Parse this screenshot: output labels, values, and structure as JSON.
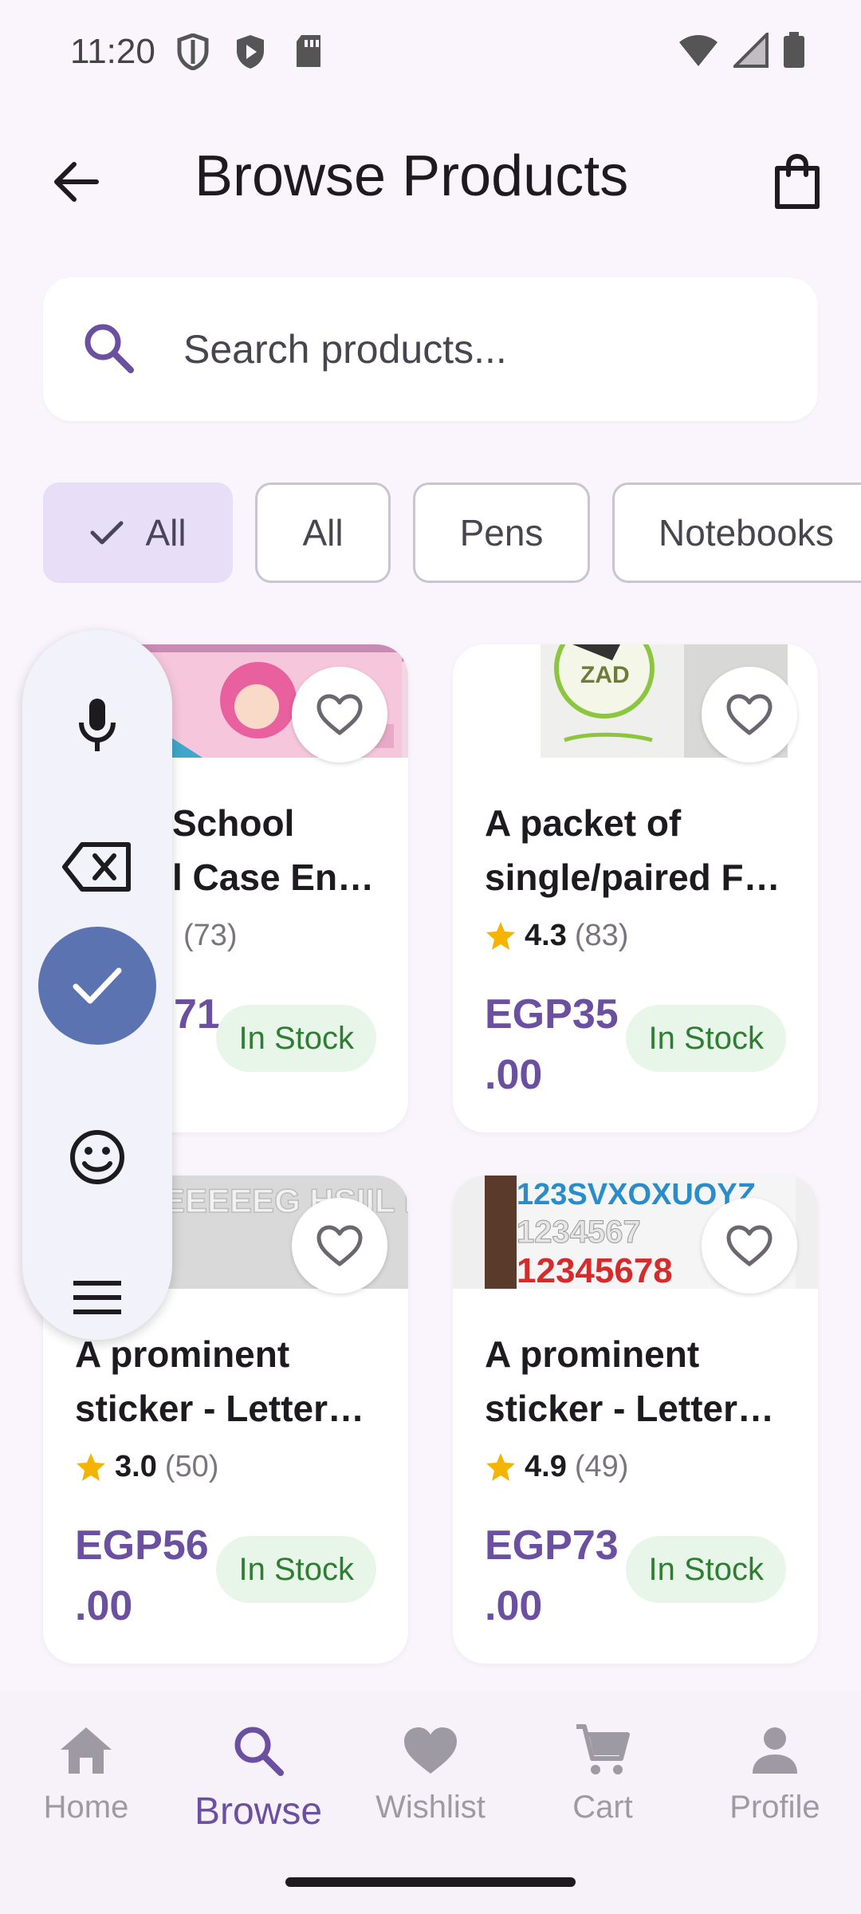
{
  "status_bar": {
    "time": "11:20"
  },
  "app_bar": {
    "title": "Browse Products"
  },
  "search": {
    "placeholder": "Search products..."
  },
  "filters": [
    {
      "label": "All",
      "selected": true
    },
    {
      "label": "All",
      "selected": false
    },
    {
      "label": "Pens",
      "selected": false
    },
    {
      "label": "Notebooks",
      "selected": false
    }
  ],
  "products": [
    {
      "title_line1": "School",
      "title_line2": "l Case En…",
      "rating": "",
      "reviews": "(73)",
      "price_line1": "71",
      "price_line2": "",
      "stock": "In Stock"
    },
    {
      "title_line1": "A packet of",
      "title_line2": "single/paired Fl…",
      "rating": "4.3",
      "reviews": "(83)",
      "price_line1": "EGP35",
      "price_line2": ".00",
      "stock": "In Stock"
    },
    {
      "title_line1": "A prominent",
      "title_line2": "sticker - Letter…",
      "rating": "3.0",
      "reviews": "(50)",
      "price_line1": "EGP56",
      "price_line2": ".00",
      "stock": "In Stock"
    },
    {
      "title_line1": "A prominent",
      "title_line2": "sticker - Letter…",
      "rating": "4.9",
      "reviews": "(49)",
      "price_line1": "EGP73",
      "price_line2": ".00",
      "stock": "In Stock"
    }
  ],
  "product_image_text": {
    "logo": "ZAD",
    "letters": "EEEEEG HSIIL MOKU",
    "numbers_top": "123SVXOXUOYZ",
    "numbers_mid": "1234567",
    "numbers_bot": "12345678"
  },
  "side_panel": {
    "icons": [
      "mic-icon",
      "backspace-icon",
      "check-icon",
      "emoji-icon",
      "menu-icon"
    ]
  },
  "bottom_nav": [
    {
      "label": "Home",
      "icon": "home-icon",
      "active": false
    },
    {
      "label": "Browse",
      "icon": "search-icon",
      "active": true
    },
    {
      "label": "Wishlist",
      "icon": "heart-icon",
      "active": false
    },
    {
      "label": "Cart",
      "icon": "cart-icon",
      "active": false
    },
    {
      "label": "Profile",
      "icon": "person-icon",
      "active": false
    }
  ],
  "colors": {
    "accent": "#6B4FA0",
    "chip_selected": "#E8DEF8",
    "stock_bg": "#E8F5E9",
    "stock_text": "#2E7D32",
    "star": "#F4B400",
    "keyboard_check": "#5B73B0"
  }
}
